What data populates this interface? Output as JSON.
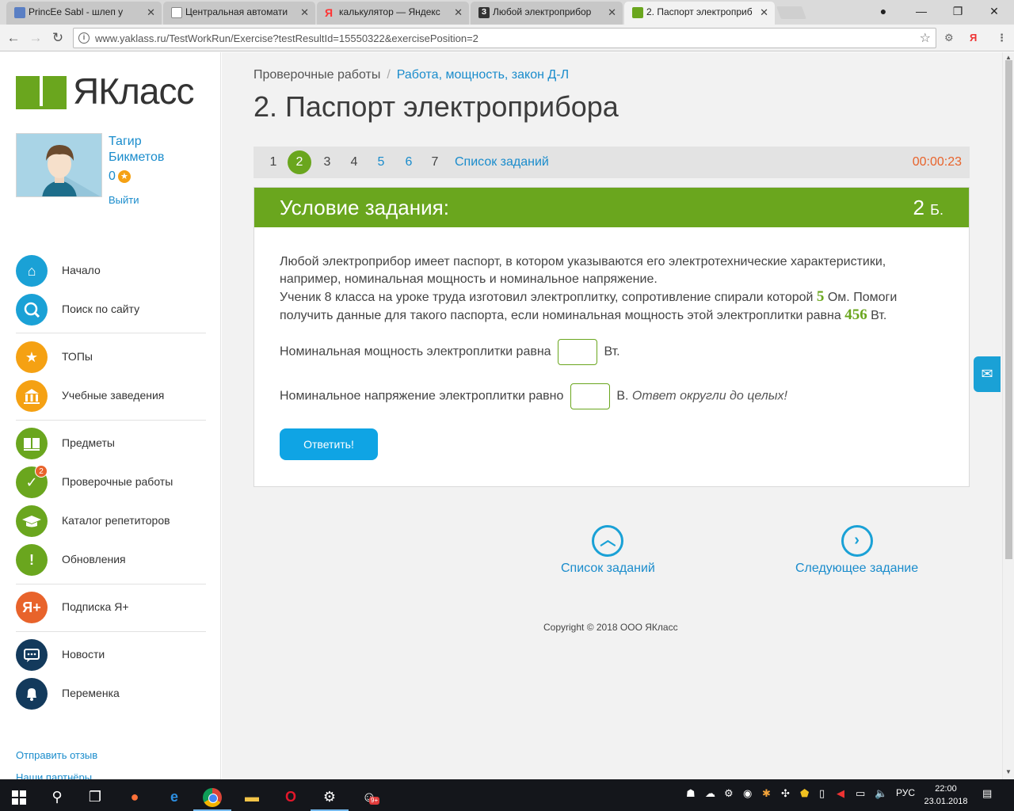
{
  "browser": {
    "tabs": [
      {
        "title": "PrincEe Sabl - шлеп у",
        "icon_color": "#5a7fc4",
        "active": false
      },
      {
        "title": "Центральная автомати",
        "icon_color": "#ffffff",
        "active": false
      },
      {
        "title": "калькулятор — Яндекс",
        "icon_color": "#ff3333",
        "active": false
      },
      {
        "title": "Любой электроприбор",
        "icon_color": "#333333",
        "active": false
      },
      {
        "title": "2. Паспорт электроприб",
        "icon_color": "#6aa61e",
        "active": true
      }
    ],
    "url": "www.yaklass.ru/TestWorkRun/Exercise?testResultId=15550322&exercisePosition=2"
  },
  "sidebar": {
    "logo_text": "ЯКласс",
    "user": {
      "name_line1": "Тагир",
      "name_line2": "Бикметов",
      "points": "0",
      "logout": "Выйти"
    },
    "menu": [
      {
        "label": "Начало",
        "icon": "home-icon",
        "color": "#1aa1d6"
      },
      {
        "label": "Поиск по сайту",
        "icon": "search-icon",
        "color": "#1aa1d6"
      },
      {
        "label": "ТОПы",
        "icon": "star-icon",
        "color": "#f5a113"
      },
      {
        "label": "Учебные заведения",
        "icon": "school-icon",
        "color": "#f5a113"
      },
      {
        "label": "Предметы",
        "icon": "book-icon",
        "color": "#6aa61e"
      },
      {
        "label": "Проверочные работы",
        "icon": "check-icon",
        "color": "#6aa61e",
        "badge": "2"
      },
      {
        "label": "Каталог репетиторов",
        "icon": "graduation-cap-icon",
        "color": "#6aa61e"
      },
      {
        "label": "Обновления",
        "icon": "exclamation-icon",
        "color": "#6aa61e"
      },
      {
        "label": "Подписка Я+",
        "icon": "yaplus-icon",
        "color": "#e8632b",
        "glyph": "Я+"
      },
      {
        "label": "Новости",
        "icon": "chat-icon",
        "color": "#133a5c"
      },
      {
        "label": "Переменка",
        "icon": "bell-icon",
        "color": "#133a5c"
      }
    ],
    "feedback": "Отправить отзыв",
    "partners": "Наши партнёры"
  },
  "main": {
    "breadcrumb_root": "Проверочные работы",
    "breadcrumb_sep": "/",
    "breadcrumb_current": "Работа, мощность, закон Д-Л",
    "title": "2. Паспорт электроприбора",
    "task_nav": {
      "numbers": [
        "1",
        "2",
        "3",
        "4",
        "5",
        "6",
        "7"
      ],
      "current": "2",
      "linked": [
        "5",
        "6"
      ],
      "list_link": "Список заданий",
      "timer": "00:00:23"
    },
    "card": {
      "header": "Условие задания:",
      "points": "2",
      "points_unit": "Б.",
      "text_part1": "Любой электроприбор имеет паспорт, в котором указываются его электротехнические характеристики, например, номинальная мощность и номинальное напряжение.",
      "text_part2": "Ученик 8 класса на уроке труда изготовил электроплитку, сопротивление спирали которой",
      "resistance": "5",
      "text_part3": "Ом. Помоги получить данные для такого паспорта, если номинальная мощность этой электроплитки равна",
      "power": "456",
      "text_part4": "Вт.",
      "q1_label": "Номинальная мощность электроплитки равна",
      "q1_unit": "Вт.",
      "q1_value": "",
      "q2_label": "Номинальное напряжение электроплитки равно",
      "q2_unit": "В.",
      "q2_hint": "Ответ округли до целых!",
      "q2_value": "",
      "submit": "Ответить!"
    },
    "bottom": {
      "list": "Список заданий",
      "next": "Следующее задание"
    },
    "copyright": "Copyright © 2018 ООО ЯКласс"
  },
  "taskbar": {
    "lang": "РУС",
    "time": "22:00",
    "date": "23.01.2018",
    "steam_badge": "9+"
  }
}
